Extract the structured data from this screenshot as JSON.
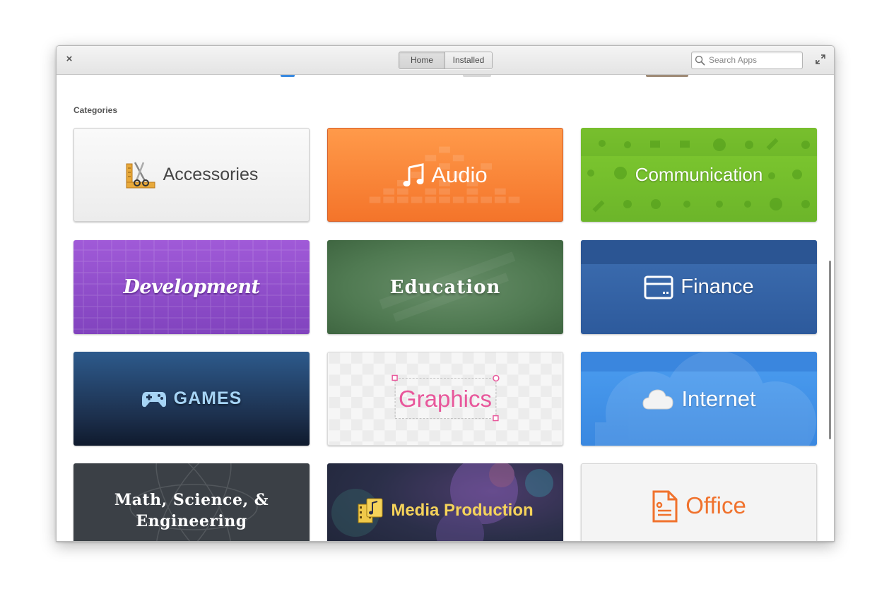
{
  "window": {
    "close_label": "×",
    "tabs": [
      {
        "label": "Home",
        "active": true
      },
      {
        "label": "Installed",
        "active": false
      }
    ],
    "search": {
      "placeholder": "Search Apps",
      "value": ""
    }
  },
  "main": {
    "section_title": "Categories",
    "categories": [
      {
        "label": "Accessories",
        "icon": "accessories-icon",
        "color": "#f2f2f2"
      },
      {
        "label": "Audio",
        "icon": "music-note-icon",
        "color": "#f7853a"
      },
      {
        "label": "Communication",
        "icon": "chat-pattern-icon",
        "color": "#7ac42e"
      },
      {
        "label": "Development",
        "icon": "",
        "color": "#9150c9"
      },
      {
        "label": "Education",
        "icon": "",
        "color": "#567e58"
      },
      {
        "label": "Finance",
        "icon": "credit-card-icon",
        "color": "#3464a6"
      },
      {
        "label": "GAMES",
        "icon": "gamepad-icon",
        "color": "#1f3553"
      },
      {
        "label": "Graphics",
        "icon": "selection-box-icon",
        "color": "#e8579b"
      },
      {
        "label": "Internet",
        "icon": "cloud-icon",
        "color": "#4294e8"
      },
      {
        "label": "Math, Science, & Engineering",
        "icon": "",
        "color": "#3b4046"
      },
      {
        "label": "Media Production",
        "icon": "film-music-icon",
        "color": "#2b2f49"
      },
      {
        "label": "Office",
        "icon": "document-icon",
        "color": "#f0722d"
      }
    ]
  }
}
